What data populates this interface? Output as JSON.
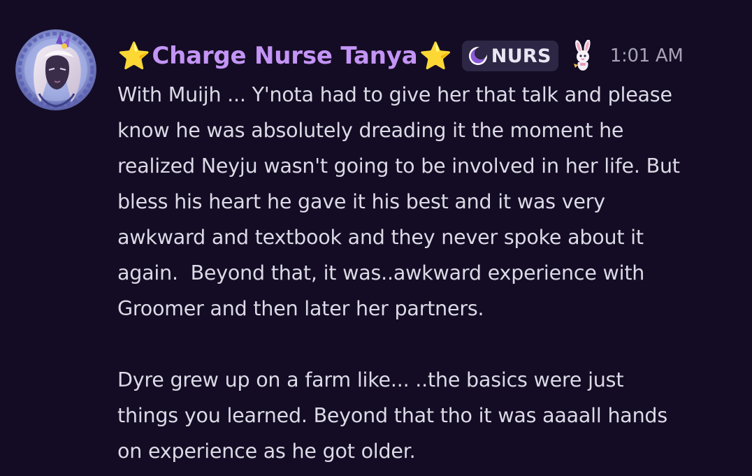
{
  "message": {
    "author": {
      "prefix_glyph": "⭐",
      "name": "Charge Nurse Tanya",
      "suffix_glyph": "⭐",
      "name_color": "#c394f5"
    },
    "role_tag": {
      "icon": "crescent-moon-icon",
      "label": "NURS"
    },
    "badge_icon": "bunny-mascot-icon",
    "timestamp": "1:01 AM",
    "paragraphs": [
      {
        "lines": [
          "With Muijh ... Y'nota had to give her that talk and please",
          "know he was absolutely dreading it the moment he",
          "realized Neyju wasn't going to be involved in her life. But",
          "bless his heart he gave it his best and it was very",
          "awkward and textbook and they never spoke about it",
          "again.  Beyond that, it was..awkward experience with",
          "Groomer and then later her partners."
        ]
      },
      {
        "lines": [
          "Dyre grew up on a farm like... ..the basics were just",
          "things you learned. Beyond that tho it was aaaall hands",
          "on experience as he got older."
        ]
      }
    ]
  },
  "theme": {
    "background": "#140c24",
    "text": "#dcdae6",
    "timestamp": "#a7a3b5",
    "role_tag_bg": "#2d2644",
    "star": "#f6b72a"
  }
}
